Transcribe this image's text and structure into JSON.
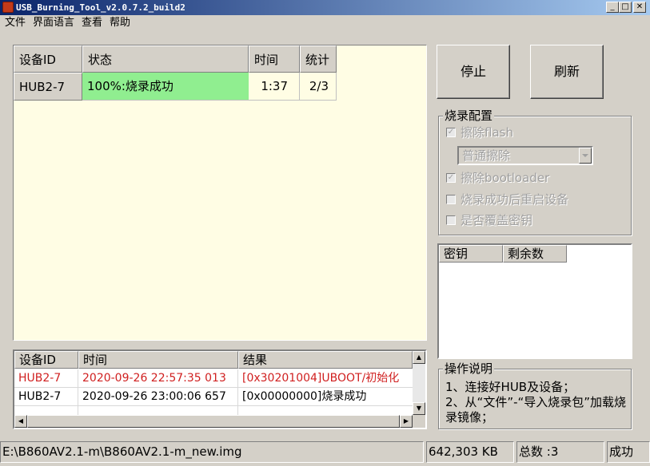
{
  "window": {
    "title": "USB_Burning_Tool_v2.0.7.2_build2",
    "min_icon": "minimize-icon",
    "max_icon": "maximize-icon",
    "close_icon": "close-icon",
    "min_glyph": "_",
    "max_glyph": "□",
    "close_glyph": "✕"
  },
  "menu": [
    "文件",
    "界面语言",
    "查看",
    "帮助"
  ],
  "devices": {
    "headers": [
      "设备ID",
      "状态",
      "时间",
      "统计"
    ],
    "rows": [
      {
        "id": "HUB2-7",
        "status": "100%:烧录成功",
        "time": "1:37",
        "count": "2/3"
      }
    ],
    "status_color": "#90ee90"
  },
  "buttons": {
    "stop": "停止",
    "refresh": "刷新"
  },
  "burn_config": {
    "title": "烧录配置",
    "erase_flash": "擦除flash",
    "erase_mode": "普通擦除",
    "erase_bootloader": "擦除bootloader",
    "reboot_after": "烧录成功后重启设备",
    "overwrite_key": "是否覆盖密钥",
    "check_glyph": "✓"
  },
  "keys": {
    "headers": [
      "密钥",
      "剩余数"
    ]
  },
  "log": {
    "headers": [
      "设备ID",
      "时间",
      "结果"
    ],
    "rows": [
      {
        "id": "HUB2-7",
        "time": "2020-09-26 22:57:35 013",
        "result": "[0x30201004]UBOOT/初始化",
        "color": "#d02020"
      },
      {
        "id": "HUB2-7",
        "time": "2020-09-26 23:00:06 657",
        "result": "[0x00000000]烧录成功",
        "color": "#000000"
      }
    ]
  },
  "instructions": {
    "title": "操作说明",
    "text": "1、连接好HUB及设备；\n2、从“文件”-“导入烧录包”加载烧录镜像；"
  },
  "statusbar": {
    "path": "E:\\B860AV2.1-m\\B860AV2.1-m_new.img",
    "size": "642,303 KB",
    "total": "总数 :3",
    "state": "成功"
  }
}
